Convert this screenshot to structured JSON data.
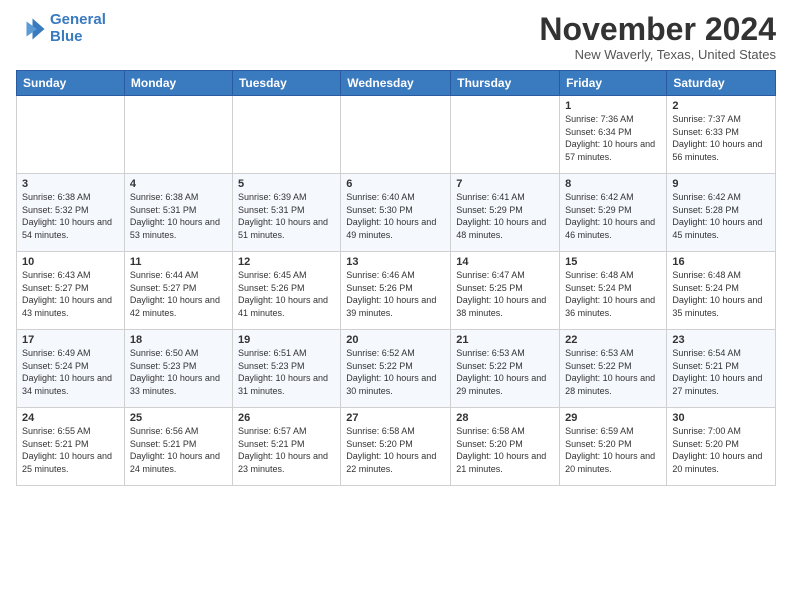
{
  "logo": {
    "line1": "General",
    "line2": "Blue"
  },
  "header": {
    "month": "November 2024",
    "location": "New Waverly, Texas, United States"
  },
  "weekdays": [
    "Sunday",
    "Monday",
    "Tuesday",
    "Wednesday",
    "Thursday",
    "Friday",
    "Saturday"
  ],
  "weeks": [
    [
      {
        "day": "",
        "info": ""
      },
      {
        "day": "",
        "info": ""
      },
      {
        "day": "",
        "info": ""
      },
      {
        "day": "",
        "info": ""
      },
      {
        "day": "",
        "info": ""
      },
      {
        "day": "1",
        "info": "Sunrise: 7:36 AM\nSunset: 6:34 PM\nDaylight: 10 hours and 57 minutes."
      },
      {
        "day": "2",
        "info": "Sunrise: 7:37 AM\nSunset: 6:33 PM\nDaylight: 10 hours and 56 minutes."
      }
    ],
    [
      {
        "day": "3",
        "info": "Sunrise: 6:38 AM\nSunset: 5:32 PM\nDaylight: 10 hours and 54 minutes."
      },
      {
        "day": "4",
        "info": "Sunrise: 6:38 AM\nSunset: 5:31 PM\nDaylight: 10 hours and 53 minutes."
      },
      {
        "day": "5",
        "info": "Sunrise: 6:39 AM\nSunset: 5:31 PM\nDaylight: 10 hours and 51 minutes."
      },
      {
        "day": "6",
        "info": "Sunrise: 6:40 AM\nSunset: 5:30 PM\nDaylight: 10 hours and 49 minutes."
      },
      {
        "day": "7",
        "info": "Sunrise: 6:41 AM\nSunset: 5:29 PM\nDaylight: 10 hours and 48 minutes."
      },
      {
        "day": "8",
        "info": "Sunrise: 6:42 AM\nSunset: 5:29 PM\nDaylight: 10 hours and 46 minutes."
      },
      {
        "day": "9",
        "info": "Sunrise: 6:42 AM\nSunset: 5:28 PM\nDaylight: 10 hours and 45 minutes."
      }
    ],
    [
      {
        "day": "10",
        "info": "Sunrise: 6:43 AM\nSunset: 5:27 PM\nDaylight: 10 hours and 43 minutes."
      },
      {
        "day": "11",
        "info": "Sunrise: 6:44 AM\nSunset: 5:27 PM\nDaylight: 10 hours and 42 minutes."
      },
      {
        "day": "12",
        "info": "Sunrise: 6:45 AM\nSunset: 5:26 PM\nDaylight: 10 hours and 41 minutes."
      },
      {
        "day": "13",
        "info": "Sunrise: 6:46 AM\nSunset: 5:26 PM\nDaylight: 10 hours and 39 minutes."
      },
      {
        "day": "14",
        "info": "Sunrise: 6:47 AM\nSunset: 5:25 PM\nDaylight: 10 hours and 38 minutes."
      },
      {
        "day": "15",
        "info": "Sunrise: 6:48 AM\nSunset: 5:24 PM\nDaylight: 10 hours and 36 minutes."
      },
      {
        "day": "16",
        "info": "Sunrise: 6:48 AM\nSunset: 5:24 PM\nDaylight: 10 hours and 35 minutes."
      }
    ],
    [
      {
        "day": "17",
        "info": "Sunrise: 6:49 AM\nSunset: 5:24 PM\nDaylight: 10 hours and 34 minutes."
      },
      {
        "day": "18",
        "info": "Sunrise: 6:50 AM\nSunset: 5:23 PM\nDaylight: 10 hours and 33 minutes."
      },
      {
        "day": "19",
        "info": "Sunrise: 6:51 AM\nSunset: 5:23 PM\nDaylight: 10 hours and 31 minutes."
      },
      {
        "day": "20",
        "info": "Sunrise: 6:52 AM\nSunset: 5:22 PM\nDaylight: 10 hours and 30 minutes."
      },
      {
        "day": "21",
        "info": "Sunrise: 6:53 AM\nSunset: 5:22 PM\nDaylight: 10 hours and 29 minutes."
      },
      {
        "day": "22",
        "info": "Sunrise: 6:53 AM\nSunset: 5:22 PM\nDaylight: 10 hours and 28 minutes."
      },
      {
        "day": "23",
        "info": "Sunrise: 6:54 AM\nSunset: 5:21 PM\nDaylight: 10 hours and 27 minutes."
      }
    ],
    [
      {
        "day": "24",
        "info": "Sunrise: 6:55 AM\nSunset: 5:21 PM\nDaylight: 10 hours and 25 minutes."
      },
      {
        "day": "25",
        "info": "Sunrise: 6:56 AM\nSunset: 5:21 PM\nDaylight: 10 hours and 24 minutes."
      },
      {
        "day": "26",
        "info": "Sunrise: 6:57 AM\nSunset: 5:21 PM\nDaylight: 10 hours and 23 minutes."
      },
      {
        "day": "27",
        "info": "Sunrise: 6:58 AM\nSunset: 5:20 PM\nDaylight: 10 hours and 22 minutes."
      },
      {
        "day": "28",
        "info": "Sunrise: 6:58 AM\nSunset: 5:20 PM\nDaylight: 10 hours and 21 minutes."
      },
      {
        "day": "29",
        "info": "Sunrise: 6:59 AM\nSunset: 5:20 PM\nDaylight: 10 hours and 20 minutes."
      },
      {
        "day": "30",
        "info": "Sunrise: 7:00 AM\nSunset: 5:20 PM\nDaylight: 10 hours and 20 minutes."
      }
    ]
  ]
}
